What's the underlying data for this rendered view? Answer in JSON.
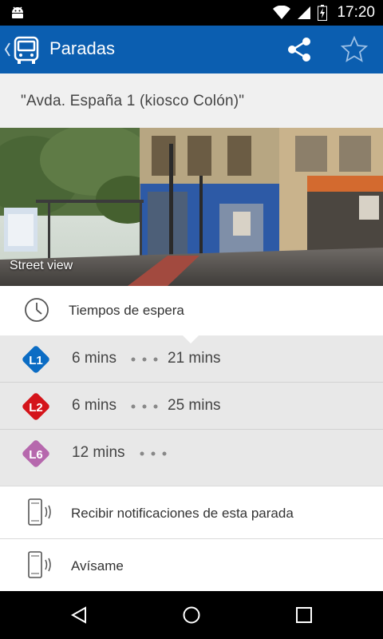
{
  "status_bar": {
    "time": "17:20",
    "icons": [
      "android-icon",
      "wifi-icon",
      "signal-icon",
      "battery-icon"
    ]
  },
  "app_bar": {
    "title": "Paradas",
    "color": "#0b5eb0",
    "icons": [
      "back-icon",
      "bus-icon",
      "share-icon",
      "star-icon"
    ]
  },
  "stop": {
    "address": "\"Avda. España 1 (kiosco Colón)\""
  },
  "street_view": {
    "label": "Street view"
  },
  "wait_times": {
    "label": "Tiempos de espera",
    "icon": "clock-icon",
    "lines": [
      {
        "code": "L1",
        "color": "#0b6cc4",
        "first": "6 mins",
        "second": "21 mins"
      },
      {
        "code": "L2",
        "color": "#d4141a",
        "first": "6 mins",
        "second": "25 mins"
      },
      {
        "code": "L6",
        "color": "#b668ad",
        "first": "12 mins",
        "second": ""
      }
    ]
  },
  "options": [
    {
      "label": "Recibir notificaciones de esta parada",
      "icon": "phone-vibrate-icon"
    },
    {
      "label": "Avísame",
      "icon": "phone-vibrate-icon"
    }
  ],
  "nav_bar": {
    "icons": [
      "nav-back-icon",
      "nav-home-icon",
      "nav-recents-icon"
    ]
  }
}
